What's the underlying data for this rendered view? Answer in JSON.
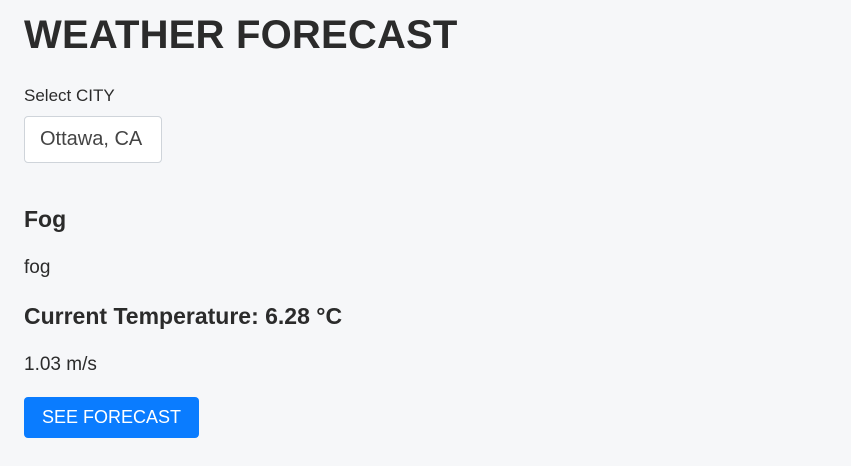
{
  "header": {
    "title": "WEATHER FORECAST"
  },
  "city": {
    "label": "Select CITY",
    "selected": "Ottawa, CA"
  },
  "weather": {
    "main": "Fog",
    "description": "fog",
    "temperature_text": "Current Temperature: 6.28 °C",
    "wind_speed": "1.03 m/s"
  },
  "actions": {
    "see_forecast_label": "SEE FORECAST"
  },
  "colors": {
    "background": "#f6f7f9",
    "text": "#2b2b2b",
    "button": "#0a7cff",
    "button_text": "#ffffff"
  }
}
